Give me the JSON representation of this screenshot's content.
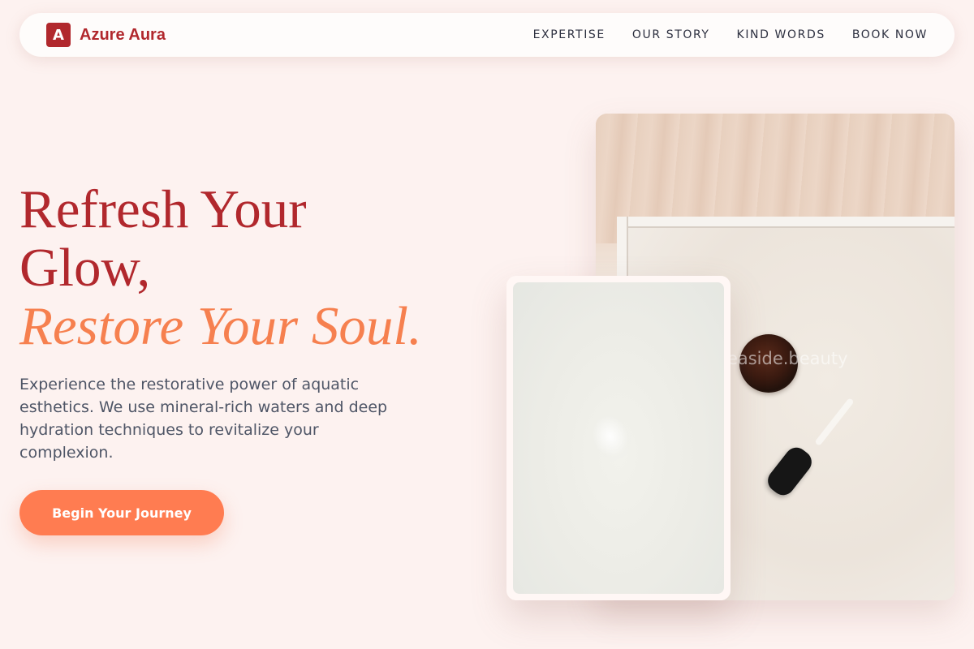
{
  "brand": {
    "mark": "A",
    "name": "Azure Aura"
  },
  "nav": {
    "links": [
      {
        "label": "EXPERTISE"
      },
      {
        "label": "OUR STORY"
      },
      {
        "label": "KIND WORDS"
      },
      {
        "label": "BOOK NOW"
      }
    ]
  },
  "hero": {
    "title_line1": "Refresh Your",
    "title_line2": "Glow,",
    "title_accent": "Restore Your Soul.",
    "description": "Experience the restorative power of aquatic esthetics. We use mineral-rich waters and deep hydration techniques to revitalize your complexion.",
    "cta_label": "Begin Your Journey"
  },
  "images": {
    "main_watermark": "@seaside.beauty"
  },
  "colors": {
    "brand_red": "#b1282d",
    "accent_orange": "#f6804f",
    "cta_bg": "#ff7c51",
    "page_bg": "#fdf2f0"
  }
}
